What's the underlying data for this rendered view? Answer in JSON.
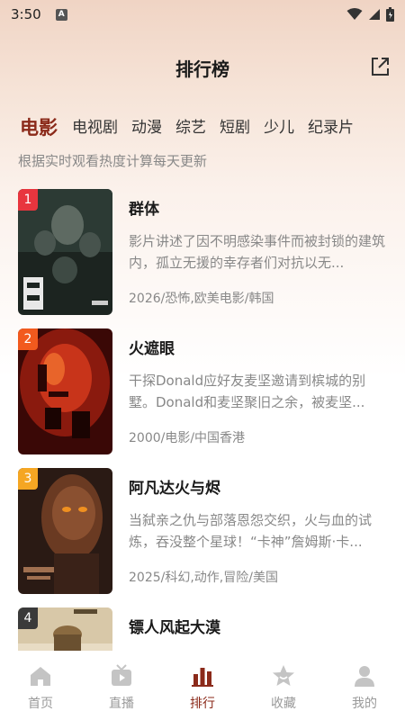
{
  "status": {
    "time": "3:50",
    "indicator": "A"
  },
  "header": {
    "title": "排行榜",
    "share_icon": "share-icon"
  },
  "tabs": [
    {
      "label": "电影",
      "active": true
    },
    {
      "label": "电视剧",
      "active": false
    },
    {
      "label": "动漫",
      "active": false
    },
    {
      "label": "综艺",
      "active": false
    },
    {
      "label": "短剧",
      "active": false
    },
    {
      "label": "少儿",
      "active": false
    },
    {
      "label": "纪录片",
      "active": false
    }
  ],
  "subtitle": "根据实时观看热度计算每天更新",
  "items": [
    {
      "rank": "1",
      "title": "群体",
      "desc": "影片讲述了因不明感染事件而被封锁的建筑内，孤立无援的幸存者们对抗以无...",
      "meta": "2026/恐怖,欧美电影/韩国",
      "badge_color": "#e8353e"
    },
    {
      "rank": "2",
      "title": "火遮眼",
      "desc": "干探Donald应好友麦坚邀请到槟城的别墅。Donald和麦坚聚旧之余，被麦坚...",
      "meta": "2000/电影/中国香港",
      "badge_color": "#f25a1e"
    },
    {
      "rank": "3",
      "title": "阿凡达火与烬",
      "desc": "当弑亲之仇与部落恩怨交织，火与血的试炼，吞没整个星球！“卡神”詹姆斯·卡...",
      "meta": "2025/科幻,动作,冒险/美国",
      "badge_color": "#f5a623"
    },
    {
      "rank": "4",
      "title": "镖人风起大漠",
      "desc": "",
      "meta": "",
      "badge_color": "#3a3a3a"
    }
  ],
  "nav": [
    {
      "label": "首页",
      "icon": "home-icon",
      "active": false
    },
    {
      "label": "直播",
      "icon": "tv-icon",
      "active": false
    },
    {
      "label": "排行",
      "icon": "ranking-icon",
      "active": true
    },
    {
      "label": "收藏",
      "icon": "star-icon",
      "active": false
    },
    {
      "label": "我的",
      "icon": "user-icon",
      "active": false
    }
  ],
  "colors": {
    "accent": "#8b2a1a",
    "inactive": "#999999"
  }
}
